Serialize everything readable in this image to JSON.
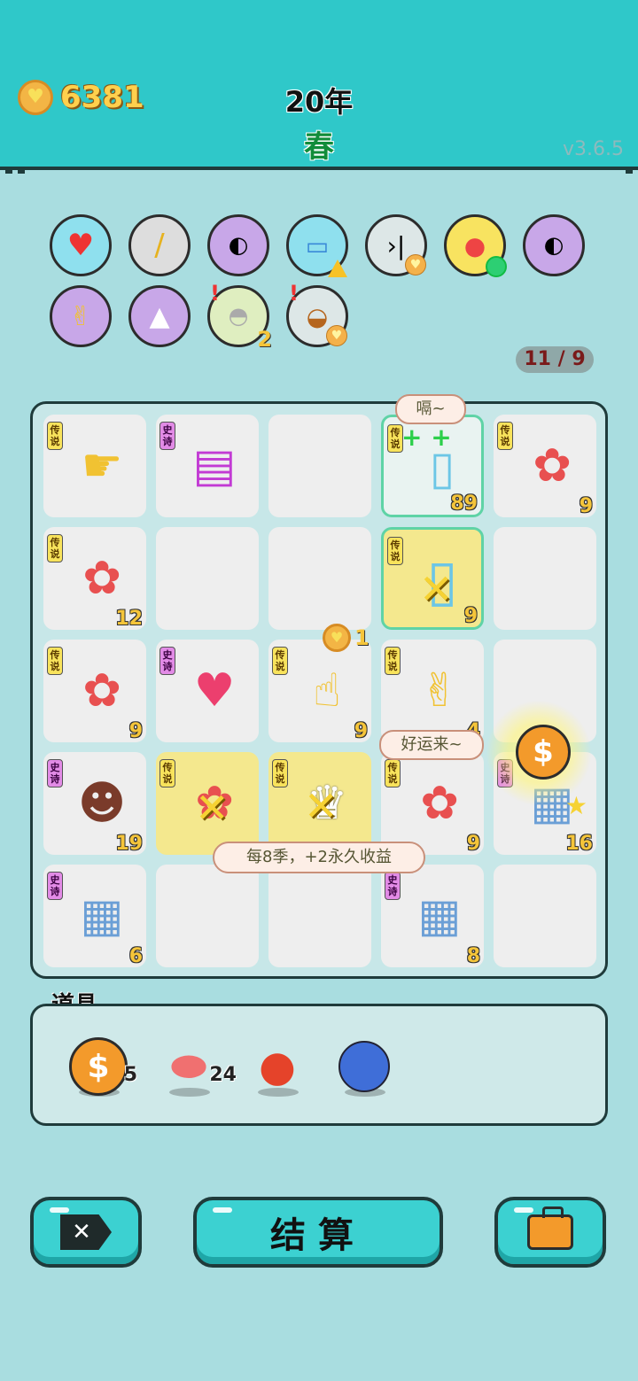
{
  "header": {
    "coins": "6381",
    "year": "20年",
    "season": "春",
    "version": "v3.6.5"
  },
  "relics": [
    {
      "name": "heart-fan-icon",
      "badge": ""
    },
    {
      "name": "screwdriver-icon",
      "badge": ""
    },
    {
      "name": "eyepatch-icon",
      "badge": ""
    },
    {
      "name": "printer-icon",
      "badge": ""
    },
    {
      "name": "skip-icon",
      "badge": ""
    },
    {
      "name": "fruit-bowl-icon",
      "badge": ""
    },
    {
      "name": "eyepatch-icon-2",
      "badge": ""
    },
    {
      "name": "rock-hand-icon",
      "badge": ""
    },
    {
      "name": "skirt-icon",
      "badge": ""
    },
    {
      "name": "shell-icon",
      "badge": "2"
    },
    {
      "name": "fruit-basket-icon",
      "badge": ""
    }
  ],
  "counter": "11 / 9",
  "tags": {
    "legend": "传说",
    "epic": "史诗"
  },
  "cells": {
    "r0c0": {
      "count": ""
    },
    "r0c3": {
      "count": "89"
    },
    "r0c4": {
      "count": "9"
    },
    "r1c0": {
      "count": "12"
    },
    "r1c3": {
      "count": "9"
    },
    "r2c0": {
      "count": "9"
    },
    "r2c2": {
      "count": "9"
    },
    "r2c3": {
      "count": "4"
    },
    "r3c0": {
      "count": "19"
    },
    "r3c3": {
      "count": "9"
    },
    "r3c4": {
      "count": "16"
    },
    "r4c0": {
      "count": "6"
    },
    "r4c3": {
      "count": "8"
    }
  },
  "floating_coin_value": "1",
  "bubbles": {
    "burp": "嗝~",
    "luck": "好运来~",
    "tooltip": "每8季，+2永久收益"
  },
  "props": {
    "title": "道具",
    "items": [
      {
        "name": "coin-item",
        "qty": "5"
      },
      {
        "name": "liver-item",
        "qty": "24"
      },
      {
        "name": "chili-item",
        "qty": ""
      },
      {
        "name": "blueberry-item",
        "qty": ""
      }
    ]
  },
  "buttons": {
    "settle": "结算"
  }
}
